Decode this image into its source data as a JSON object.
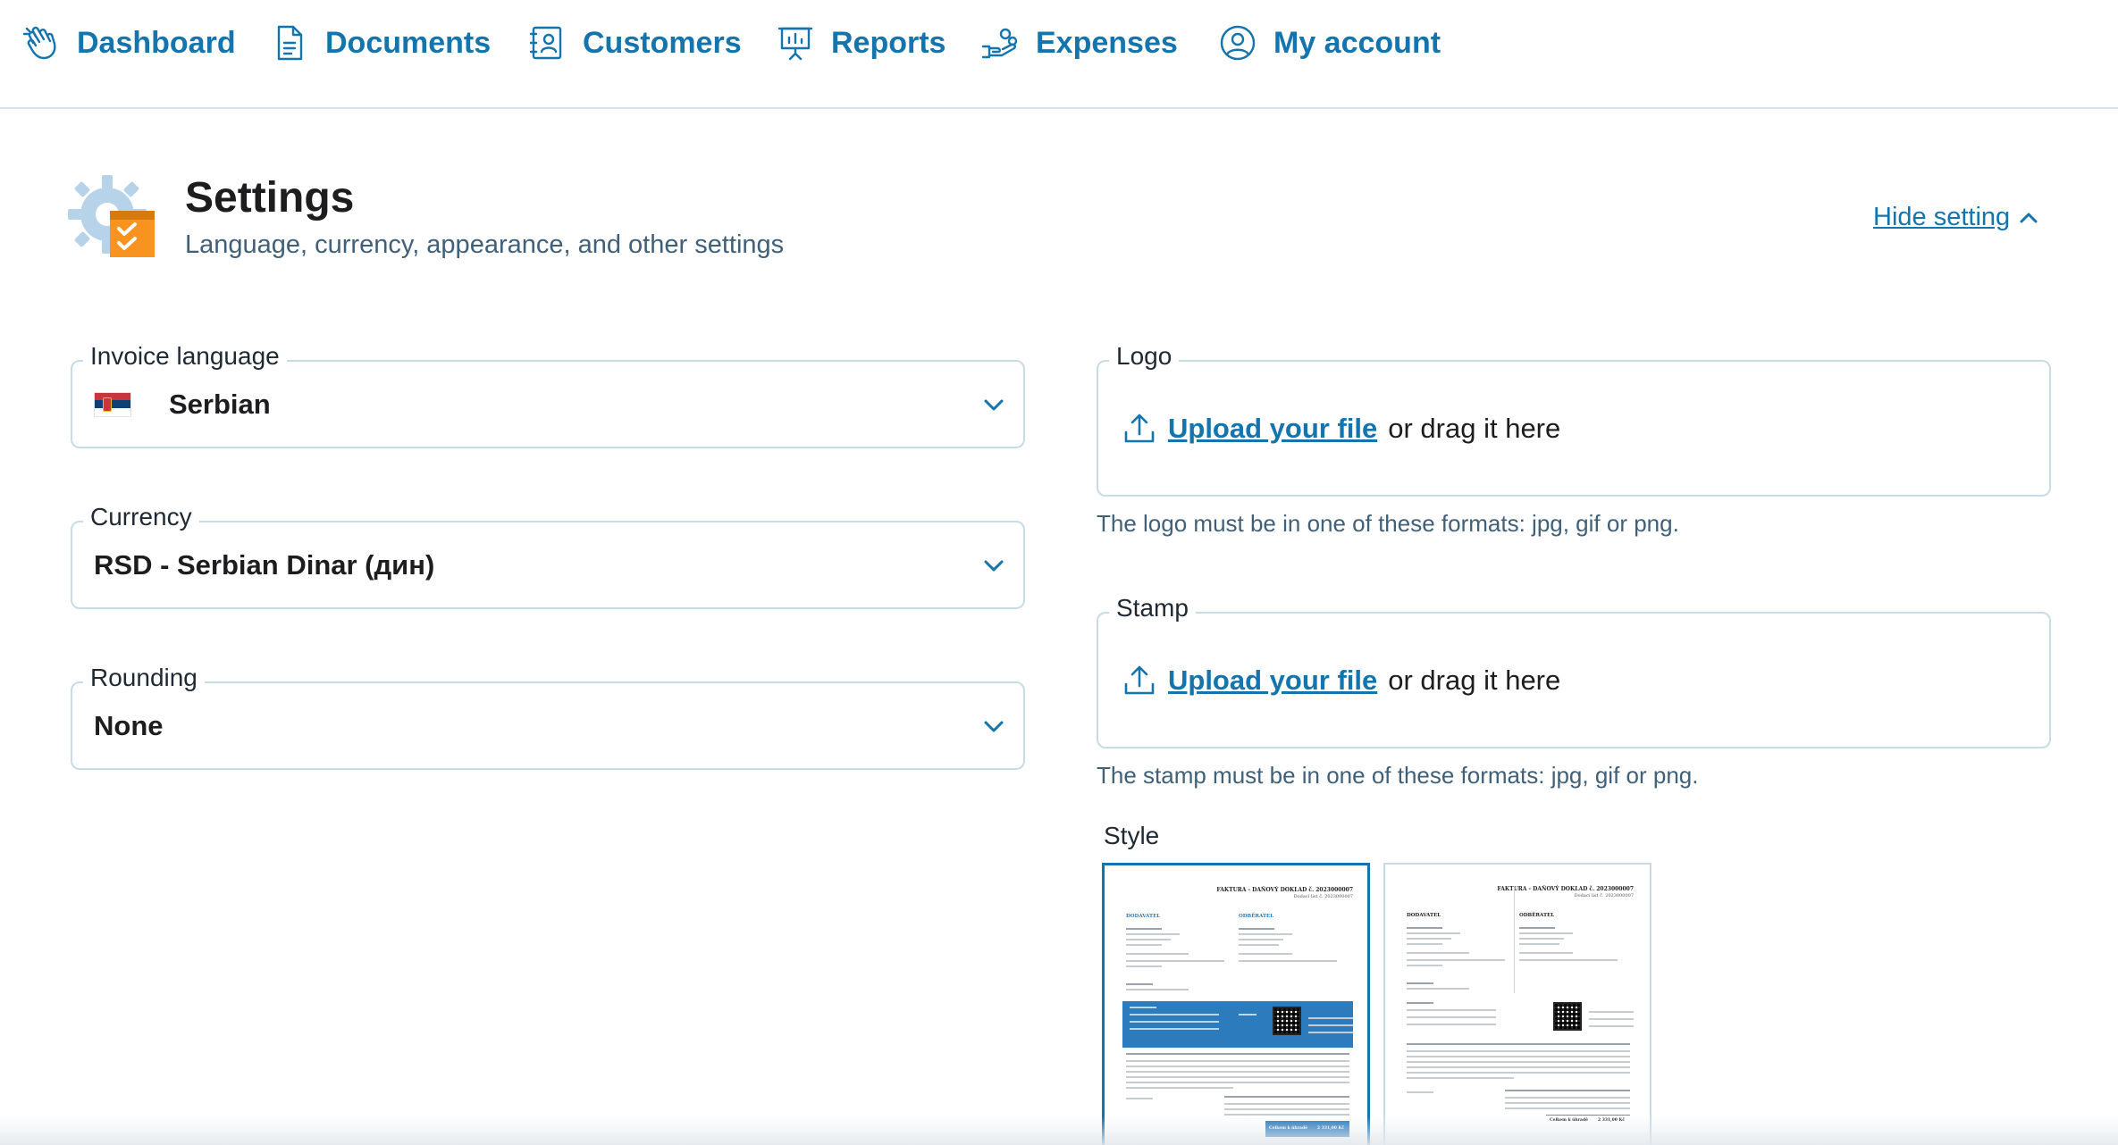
{
  "nav": {
    "items": [
      {
        "label": "Dashboard",
        "icon": "hand-wave-icon"
      },
      {
        "label": "Documents",
        "icon": "document-icon"
      },
      {
        "label": "Customers",
        "icon": "contact-book-icon"
      },
      {
        "label": "Reports",
        "icon": "presentation-chart-icon"
      },
      {
        "label": "Expenses",
        "icon": "hand-coins-icon"
      },
      {
        "label": "My account",
        "icon": "user-circle-icon"
      }
    ]
  },
  "header": {
    "title": "Settings",
    "subtitle": "Language, currency, appearance, and other settings",
    "toggle_label": "Hide setting"
  },
  "form": {
    "invoice_language": {
      "label": "Invoice language",
      "value": "Serbian",
      "flag": "serbia-flag-icon"
    },
    "currency": {
      "label": "Currency",
      "value": "RSD - Serbian Dinar (дин)"
    },
    "rounding": {
      "label": "Rounding",
      "value": "None"
    }
  },
  "logo": {
    "label": "Logo",
    "upload_link": "Upload your file",
    "upload_rest": "or drag it here",
    "hint": "The logo must be in one of these formats: jpg, gif or png."
  },
  "stamp": {
    "label": "Stamp",
    "upload_link": "Upload your file",
    "upload_rest": "or drag it here",
    "hint": "The stamp must be in one of these formats: jpg, gif or png."
  },
  "style": {
    "label": "Style",
    "selected": 0,
    "thumbnails": [
      {
        "title": "FAKTURA - DAŇOVÝ DOKLAD č. 2023000007",
        "sub": "Dodací list č. 2023000007",
        "supplier": "DODAVATEL",
        "customer": "ODBĚRATEL",
        "total": "Celkem k úhradě",
        "amount": "2 331,00 Kč"
      },
      {
        "title": "FAKTURA - DAŇOVÝ DOKLAD č. 2023000007",
        "sub": "Dodací list č. 2023000007",
        "supplier": "DODAVATEL",
        "customer": "ODBĚRATEL",
        "total": "Celkem k úhradě",
        "amount": "2 331,00 Kč"
      }
    ]
  },
  "colors": {
    "accent": "#1474ad",
    "border": "#c9dbe6",
    "muted": "#3f6078",
    "band": "#2b7bbd",
    "icon_orange": "#f7931e"
  }
}
